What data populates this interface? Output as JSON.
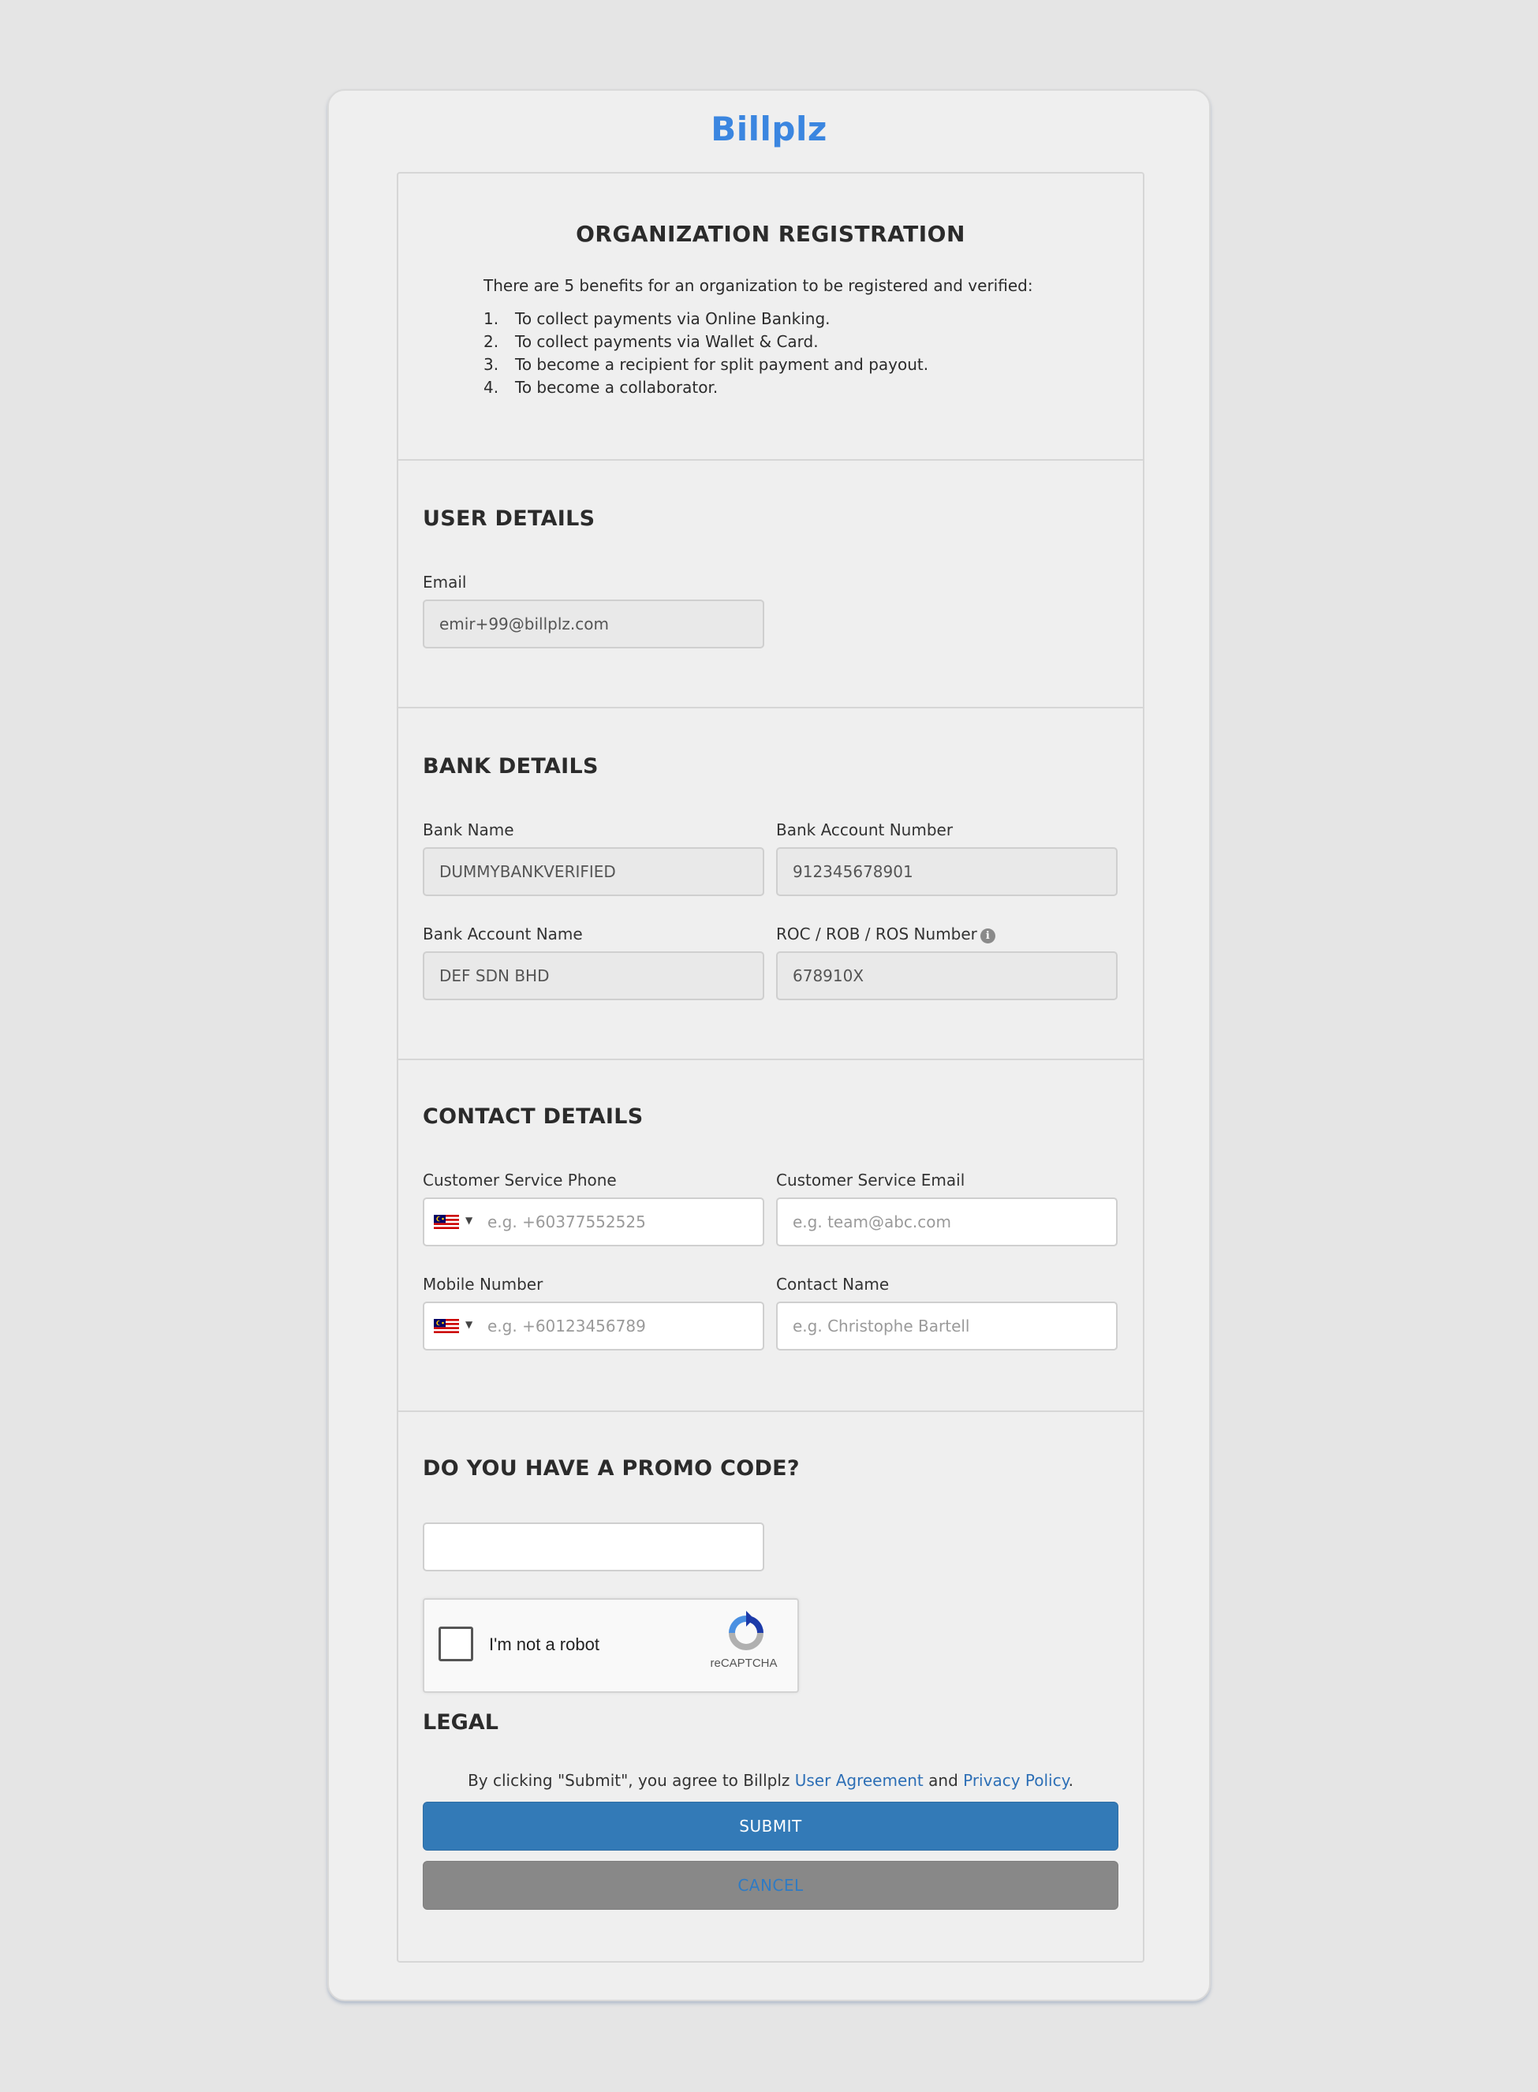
{
  "brand": {
    "logo_text": "Billplz",
    "logo_color": "#3b86e0"
  },
  "registration": {
    "title": "ORGANIZATION REGISTRATION",
    "intro": "There are 5 benefits for an organization to be registered and verified:",
    "benefits": [
      {
        "num": "1.",
        "text": "To collect payments via Online Banking."
      },
      {
        "num": "2.",
        "text": "To collect payments via Wallet & Card."
      },
      {
        "num": "3.",
        "text": "To become a recipient for split payment and payout."
      },
      {
        "num": "4.",
        "text": "To become a collaborator."
      }
    ]
  },
  "user_details": {
    "title": "USER DETAILS",
    "email_label": "Email",
    "email_value": "emir+99@billplz.com"
  },
  "bank_details": {
    "title": "BANK DETAILS",
    "bank_name_label": "Bank Name",
    "bank_name_value": "DUMMYBANKVERIFIED",
    "account_number_label": "Bank Account Number",
    "account_number_value": "912345678901",
    "account_name_label": "Bank Account Name",
    "account_name_value": "DEF SDN BHD",
    "roc_label": "ROC / ROB / ROS Number",
    "roc_value": "678910X",
    "info_icon": "info-icon"
  },
  "contact_details": {
    "title": "CONTACT DETAILS",
    "cs_phone_label": "Customer Service Phone",
    "cs_phone_placeholder": "e.g. +60377552525",
    "cs_email_label": "Customer Service Email",
    "cs_email_placeholder": "e.g. team@abc.com",
    "mobile_label": "Mobile Number",
    "mobile_placeholder": "e.g. +60123456789",
    "contact_name_label": "Contact Name",
    "contact_name_placeholder": "e.g. Christophe Bartell",
    "country_flag_icon": "malaysia-flag-icon"
  },
  "promo": {
    "title": "DO YOU HAVE A PROMO CODE?",
    "value": ""
  },
  "captcha": {
    "label": "I'm not a robot",
    "brand": "reCAPTCHA"
  },
  "legal": {
    "title": "LEGAL",
    "text_before": "By clicking \"Submit\", you agree to Billplz ",
    "user_agreement_link": "User Agreement",
    "text_and": " and ",
    "privacy_link": "Privacy Policy",
    "text_end": "."
  },
  "actions": {
    "submit_label": "SUBMIT",
    "cancel_label": "CANCEL",
    "submit_color": "#337ab7",
    "cancel_color": "#888888"
  }
}
